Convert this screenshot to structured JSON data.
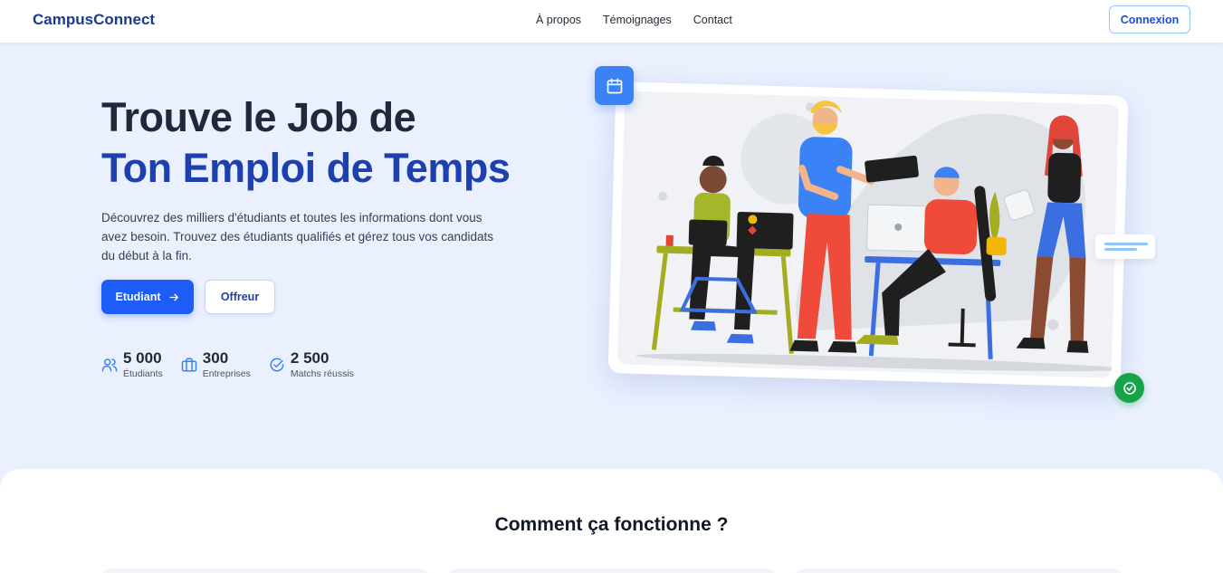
{
  "navbar": {
    "brand": "CampusConnect",
    "links": [
      "À propos",
      "Témoignages",
      "Contact"
    ],
    "login_label": "Connexion"
  },
  "hero": {
    "title_line1": "Trouve le Job de",
    "title_line2": "Ton Emploi de Temps",
    "description": "Découvrez des milliers d'étudiants et toutes les informations dont vous avez besoin. Trouvez des étudiants qualifiés et gérez tous vos candidats du début à la fin.",
    "primary_button": "Etudiant",
    "secondary_button": "Offreur"
  },
  "stats": [
    {
      "value": "5 000",
      "label": "Étudiants",
      "icon": "users-icon"
    },
    {
      "value": "300",
      "label": "Entreprises",
      "icon": "briefcase-icon"
    },
    {
      "value": "2 500",
      "label": "Matchs réussis",
      "icon": "check-circle-icon"
    }
  ],
  "how": {
    "title": "Comment ça fonctionne ?"
  },
  "colors": {
    "brand": "#1e3a8a",
    "primary": "#1d5cf5",
    "accent_title": "#1e40af",
    "success": "#16a34a",
    "background": "#eaf0fd"
  }
}
